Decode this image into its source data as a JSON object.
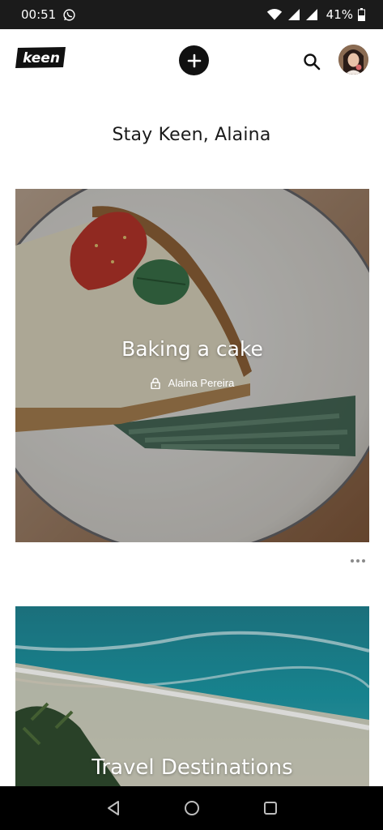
{
  "status_bar": {
    "time": "00:51",
    "battery": "41%",
    "icons": [
      "whatsapp-icon",
      "wifi-icon",
      "signal-icon",
      "signal-icon",
      "battery-icon"
    ]
  },
  "header": {
    "logo_text": "keen",
    "add_icon": "plus-icon",
    "search_icon": "search-icon",
    "avatar_icon": "user-avatar"
  },
  "greeting": "Stay Keen, Alaina",
  "cards": [
    {
      "title": "Baking a cake",
      "author": "Alaina Pereira",
      "privacy_icon": "lock-icon"
    },
    {
      "title": "Travel Destinations"
    }
  ],
  "more_icon": "more-horizontal-icon",
  "nav_bar": {
    "icons": [
      "back-icon",
      "home-icon",
      "recent-apps-icon"
    ]
  }
}
